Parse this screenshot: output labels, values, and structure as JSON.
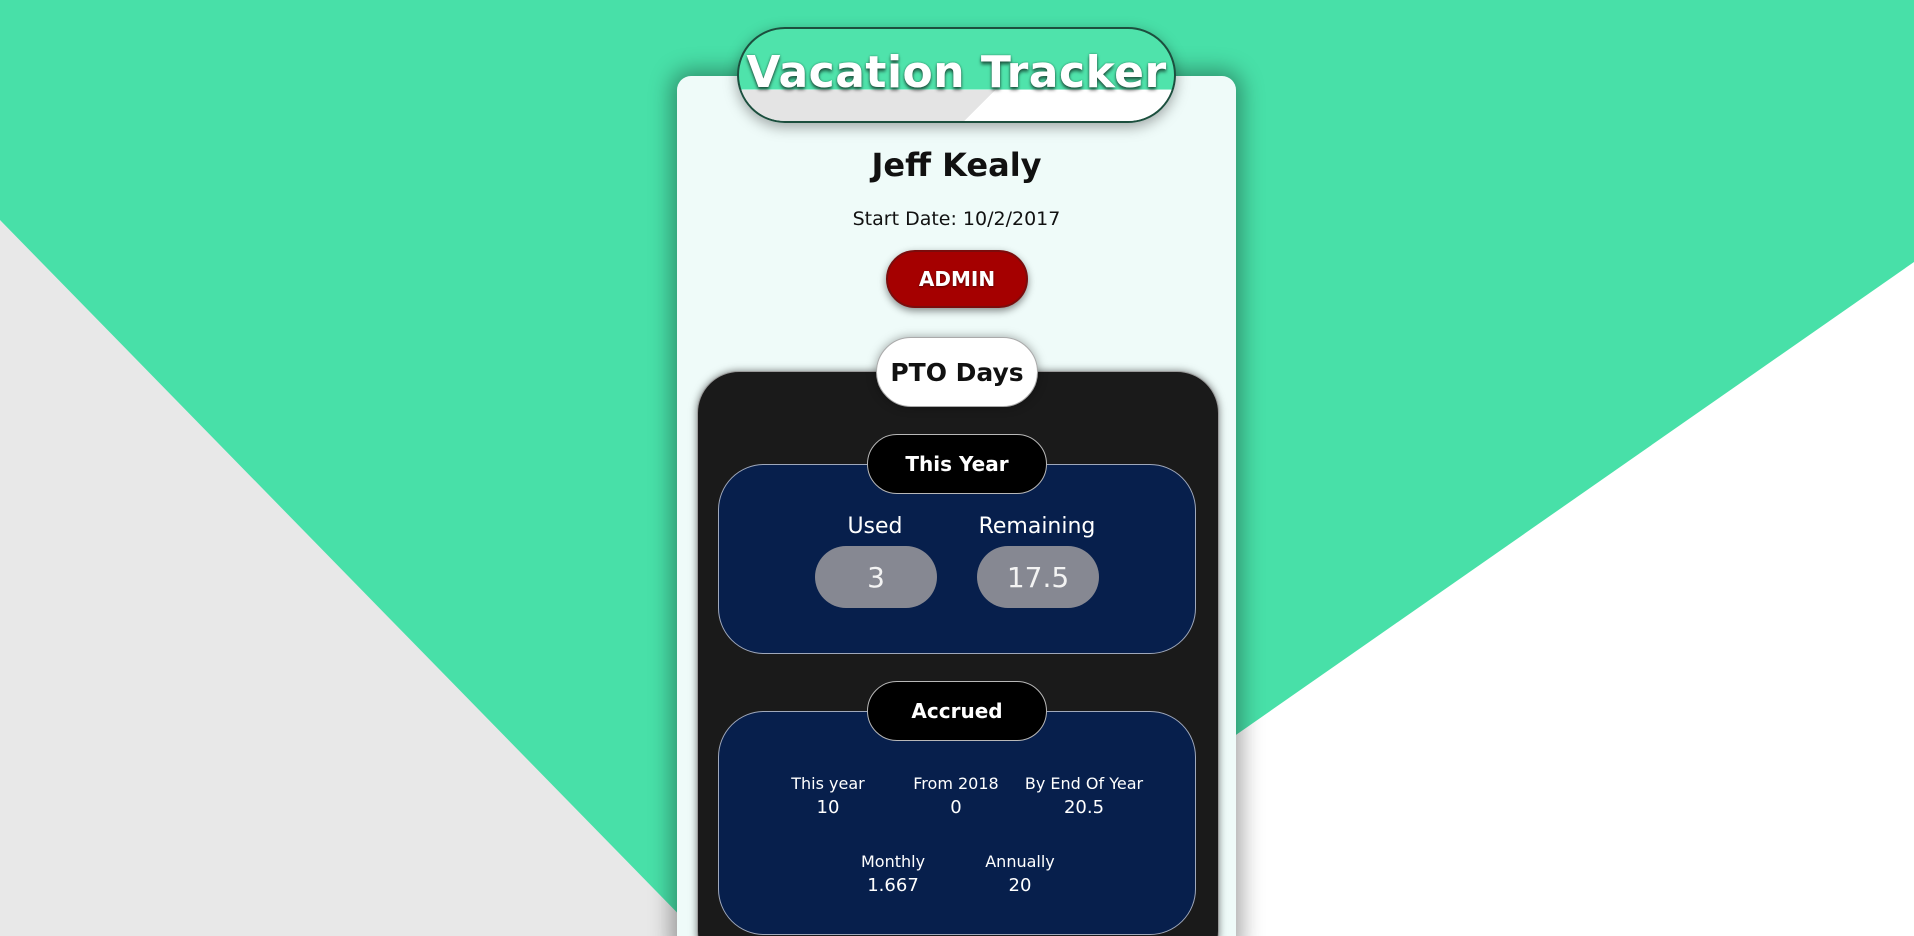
{
  "app": {
    "title": "Vacation Tracker"
  },
  "profile": {
    "name": "Jeff Kealy",
    "start_date": "Start Date: 10/2/2017",
    "admin_label": "ADMIN"
  },
  "pto": {
    "heading": "PTO Days",
    "this_year": {
      "heading": "This Year",
      "used_label": "Used",
      "used_value": "3",
      "remaining_label": "Remaining",
      "remaining_value": "17.5"
    },
    "accrued": {
      "heading": "Accrued",
      "items": [
        {
          "label": "This year",
          "value": "10"
        },
        {
          "label": "From 2018",
          "value": "0"
        },
        {
          "label": "By End Of Year",
          "value": "20.5"
        },
        {
          "label": "Monthly",
          "value": "1.667"
        },
        {
          "label": "Annually",
          "value": "20"
        }
      ]
    }
  },
  "colors": {
    "brand_green": "#48e0a8",
    "admin_red": "#a50000",
    "panel_dark": "#1a1a1a",
    "section_navy": "#071f4c",
    "pill_gray": "#868892"
  }
}
